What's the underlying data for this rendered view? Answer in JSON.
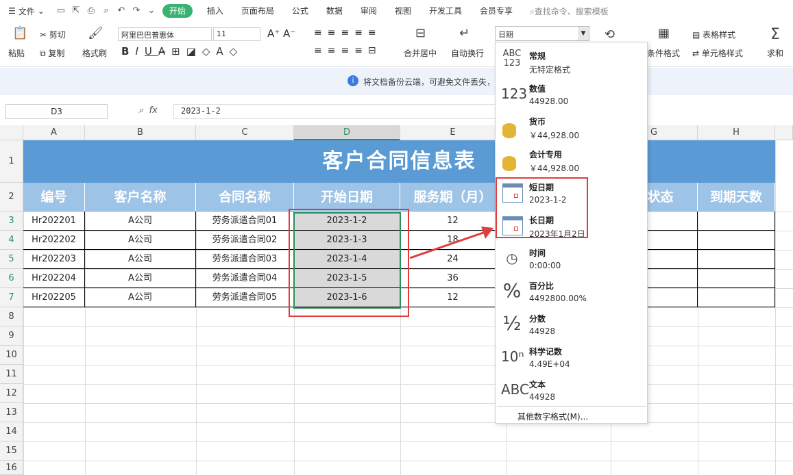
{
  "menubar": {
    "file_label": "文件",
    "tabs": [
      "开始",
      "插入",
      "页面布局",
      "公式",
      "数据",
      "审阅",
      "视图",
      "开发工具",
      "会员专享"
    ],
    "search_placeholder": "查找命令、搜索模板"
  },
  "ribbon": {
    "paste": "粘贴",
    "cut": "剪切",
    "copy": "复制",
    "format_painter": "格式刷",
    "font_name": "阿里巴巴普惠体",
    "font_size": "11",
    "merge_center": "合并居中",
    "wrap_text": "自动换行",
    "number_format": "日期",
    "cond_format": "条件格式",
    "table_style": "表格样式",
    "cell_style": "单元格样式",
    "sum": "求和"
  },
  "info_bar": {
    "text": "将文档备份云端，可避免文件丢失，"
  },
  "formula_bar": {
    "cell_ref": "D3",
    "fx_value": "2023-1-2"
  },
  "columns": [
    "A",
    "B",
    "C",
    "D",
    "E",
    "F",
    "G",
    "H"
  ],
  "rows": [
    "1",
    "2",
    "3",
    "4",
    "5",
    "6",
    "7",
    "8",
    "9",
    "10",
    "11",
    "12",
    "13",
    "14",
    "15",
    "16"
  ],
  "sheet": {
    "title": "客户合同信息表",
    "headers": [
      "编号",
      "客户名称",
      "合同名称",
      "开始日期",
      "服务期（月）",
      "",
      "同状态",
      "到期天数"
    ],
    "data": [
      [
        "Hr202201",
        "A公司",
        "劳务派遣合同01",
        "2023-1-2",
        "12"
      ],
      [
        "Hr202202",
        "A公司",
        "劳务派遣合同02",
        "2023-1-3",
        "18"
      ],
      [
        "Hr202203",
        "A公司",
        "劳务派遣合同03",
        "2023-1-4",
        "24"
      ],
      [
        "Hr202204",
        "A公司",
        "劳务派遣合同04",
        "2023-1-5",
        "36"
      ],
      [
        "Hr202205",
        "A公司",
        "劳务派遣合同05",
        "2023-1-6",
        "12"
      ]
    ]
  },
  "format_dropdown": {
    "items": [
      {
        "name": "常规",
        "example": "无特定格式",
        "icon": "abc-123-icon"
      },
      {
        "name": "数值",
        "example": "44928.00",
        "icon": "number-123-icon"
      },
      {
        "name": "货币",
        "example": "￥44,928.00",
        "icon": "currency-coins-icon"
      },
      {
        "name": "会计专用",
        "example": "￥44,928.00",
        "icon": "accounting-icon"
      },
      {
        "name": "短日期",
        "example": "2023-1-2",
        "icon": "calendar-icon"
      },
      {
        "name": "长日期",
        "example": "2023年1月2日",
        "icon": "calendar-icon"
      },
      {
        "name": "时间",
        "example": "0:00:00",
        "icon": "clock-icon"
      },
      {
        "name": "百分比",
        "example": "4492800.00%",
        "icon": "percent-icon"
      },
      {
        "name": "分数",
        "example": "44928",
        "icon": "fraction-icon"
      },
      {
        "name": "科学记数",
        "example": "4.49E+04",
        "icon": "scientific-icon"
      },
      {
        "name": "文本",
        "example": "44928",
        "icon": "text-abc-icon"
      }
    ],
    "more": "其他数字格式(M)..."
  }
}
